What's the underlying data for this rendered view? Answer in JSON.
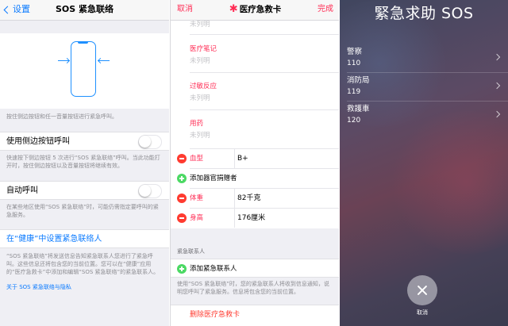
{
  "sos_settings": {
    "back_label": "设置",
    "title": "SOS 紧急联络",
    "illustration_note": "按住侧边按钮和任一音量按钮进行紧急呼叫。",
    "side_button_call": {
      "label": "使用侧边按钮呼叫",
      "enabled": false,
      "note": "快速按下侧边按钮 5 次进行“SOS 紧急联络”呼叫。当此功能打开时，按住侧边按钮以及音量按钮将继续有效。"
    },
    "auto_call": {
      "label": "自动呼叫",
      "enabled": false,
      "note": "在某些地区使用“SOS 紧急联络”时，可能仍需指定要呼叫的紧急服务。"
    },
    "health_link": "在“健康”中设置紧急联络人",
    "footer_note": "“SOS 紧急联络”将发送信息告知紧急联系人您进行了紧急呼叫。这些信息还将包含您的当前位置。您可以在“健康”应用的“医疗急救卡”中添加和编辑“SOS 紧急联络”的紧急联系人。",
    "footer_link": "关于 SOS 紧急联络与隐私"
  },
  "medical_id": {
    "cancel_label": "取消",
    "title_star": "✱",
    "title": "医疗急救卡",
    "done_label": "完成",
    "fields": [
      {
        "label": "医疗笔记",
        "value": "未列明"
      },
      {
        "label": "过敏反应",
        "value": "未列明"
      },
      {
        "label": "用药",
        "value": "未列明"
      }
    ],
    "top_value": "未列明",
    "blood_type": {
      "label": "血型",
      "value": "B+"
    },
    "add_organ_donor": "添加器官捐赠者",
    "weight": {
      "label": "体重",
      "value": "82千克"
    },
    "height": {
      "label": "身高",
      "value": "176厘米"
    },
    "emergency_contacts_header": "紧急联系人",
    "add_emergency_contact": "添加紧急联系人",
    "contacts_note": "使用“SOS 紧急联络”时，您的紧急联系人将收到信息通知，说明您呼叫了紧急服务。信息将包含您的当前位置。",
    "delete_label": "删除医疗急救卡"
  },
  "emergency_sos": {
    "title": "緊急求助 SOS",
    "contacts": [
      {
        "name": "警察",
        "number": "110"
      },
      {
        "name": "消防局",
        "number": "119"
      },
      {
        "name": "救護車",
        "number": "120"
      }
    ],
    "cancel_label": "取消"
  }
}
